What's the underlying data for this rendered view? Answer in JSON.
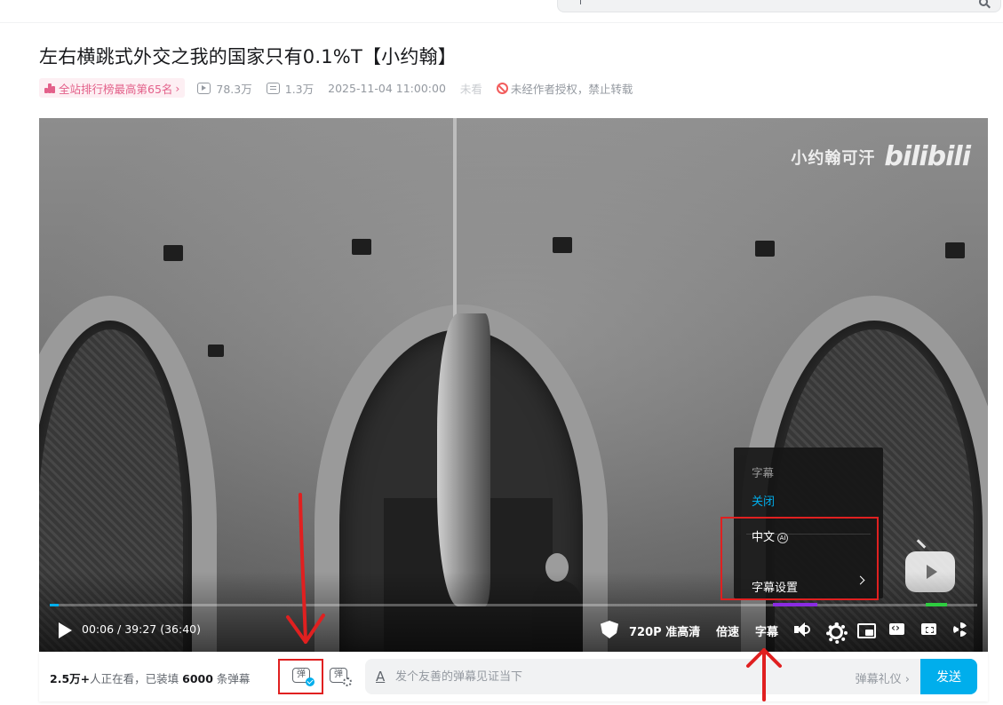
{
  "video": {
    "title": "左右横跳式外交之我的国家只有0.1%T【小约翰】",
    "rank_badge": "全站排行榜最高第65名",
    "views": "78.3万",
    "danmaku_count": "1.3万",
    "publish_time": "2025-11-04 11:00:00",
    "watch_status": "未看",
    "copyright_notice": "未经作者授权，禁止转载"
  },
  "player": {
    "watermark_author": "小约翰可汗",
    "watermark_logo": "bilibili",
    "time_current": "00:06",
    "time_separator": "/",
    "time_total": "39:27 (36:40)",
    "progress": 0.003,
    "quality": "720P 准高清",
    "speed": "倍速",
    "subtitle": "字幕"
  },
  "subtitle_menu": {
    "header": "字幕",
    "off": "关闭",
    "chinese": "中文",
    "ai_tag": "AI",
    "settings": "字幕设置"
  },
  "danmaku_bar": {
    "viewers_count": "2.5万+",
    "viewers_text": "人正在看，已装填",
    "loaded_count": "6000",
    "loaded_suffix": "条弹幕",
    "toggle_glyph": "弹",
    "input_placeholder": "发个友善的弹幕见证当下",
    "etiquette": "弹幕礼仪",
    "send": "发送"
  },
  "colors": {
    "accent": "#00aeec",
    "rank_pink": "#e3608a",
    "annotation_red": "#e02020"
  }
}
